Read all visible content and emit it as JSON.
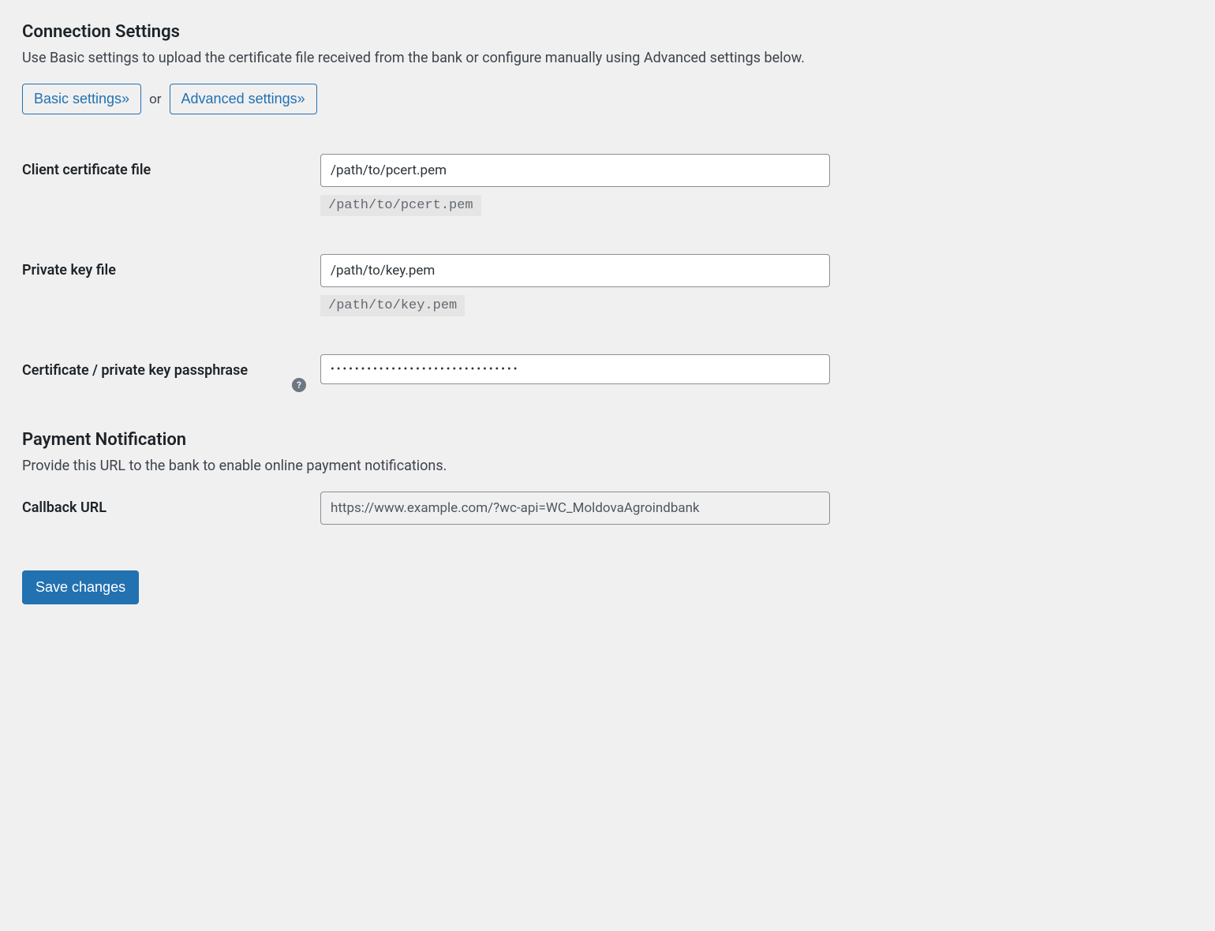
{
  "section1": {
    "heading": "Connection Settings",
    "description": "Use Basic settings to upload the certificate file received from the bank or configure manually using Advanced settings below.",
    "basic_button": "Basic settings»",
    "or_text": "or",
    "advanced_button": "Advanced settings»"
  },
  "fields": {
    "client_cert": {
      "label": "Client certificate file",
      "value": "/path/to/pcert.pem",
      "hint": "/path/to/pcert.pem"
    },
    "private_key": {
      "label": "Private key file",
      "value": "/path/to/key.pem",
      "hint": "/path/to/key.pem"
    },
    "passphrase": {
      "label": "Certificate / private key passphrase",
      "value": "•••••••••••••••••••••••••••••••",
      "help": "?"
    },
    "callback": {
      "label": "Callback URL",
      "value": "https://www.example.com/?wc-api=WC_MoldovaAgroindbank"
    }
  },
  "section2": {
    "heading": "Payment Notification",
    "description": "Provide this URL to the bank to enable online payment notifications."
  },
  "save_button": "Save changes"
}
